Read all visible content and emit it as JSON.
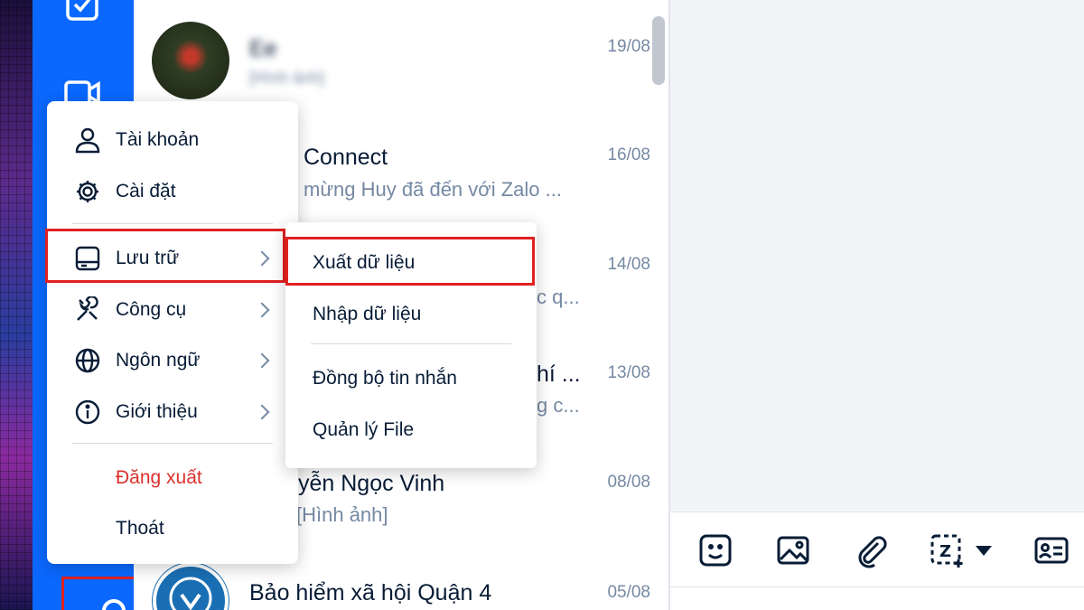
{
  "menu": {
    "items": [
      {
        "label": "Tài khoản",
        "icon": "user-icon"
      },
      {
        "label": "Cài đặt",
        "icon": "gear-icon"
      },
      {
        "label": "Lưu trữ",
        "icon": "storage-icon"
      },
      {
        "label": "Công cụ",
        "icon": "tools-icon"
      },
      {
        "label": "Ngôn ngữ",
        "icon": "globe-icon"
      },
      {
        "label": "Giới thiệu",
        "icon": "info-icon"
      }
    ],
    "logout": "Đăng xuất",
    "exit": "Thoát"
  },
  "submenu": {
    "items": [
      "Xuất dữ liệu",
      "Nhập dữ liệu",
      "Đồng bộ tin nhắn",
      "Quản lý File"
    ]
  },
  "conversations": [
    {
      "name": "Ee",
      "snippet": "[Hình ảnh]",
      "date": "19/08"
    },
    {
      "name": "Connect",
      "snippet": "mừng Huy đã đến với Zalo ...",
      "date": "16/08"
    },
    {
      "name": "",
      "snippet": "c q...",
      "date": "14/08"
    },
    {
      "name": "hí ...",
      "snippet": "g c...",
      "date": "13/08"
    },
    {
      "name": "yễn Ngọc Vinh",
      "snippet": "[Hình ảnh]",
      "date": "08/08"
    },
    {
      "name": "Bảo hiểm xã hội Quận 4",
      "snippet": "",
      "date": "05/08"
    }
  ],
  "toolbar": {
    "icons": [
      "sticker-icon",
      "image-icon",
      "attachment-icon",
      "screenshot-icon",
      "dropdown-icon",
      "contact-card-icon"
    ],
    "screenshot_letter": "Z"
  },
  "colors": {
    "nav_blue": "#0a68fe",
    "highlight_red": "#e02020",
    "logout_red": "#d9312c",
    "text_primary": "#081c36",
    "text_secondary": "#7589a3"
  }
}
